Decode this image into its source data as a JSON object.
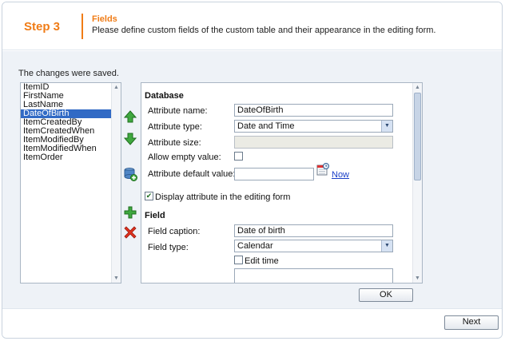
{
  "header": {
    "step": "Step 3",
    "title": "Fields",
    "description": "Please define custom fields of the custom table and their appearance in the editing form."
  },
  "status": {
    "message": "The changes were saved."
  },
  "attribute_list": {
    "items": [
      "ItemID",
      "FirstName",
      "LastName",
      "DateOfBirth",
      "ItemCreatedBy",
      "ItemCreatedWhen",
      "ItemModifiedBy",
      "ItemModifiedWhen",
      "ItemOrder"
    ],
    "selected": "DateOfBirth"
  },
  "toolbar_icons": [
    "move-up-icon",
    "move-down-icon",
    "new-field-from-db-icon",
    "add-field-icon",
    "delete-field-icon"
  ],
  "form": {
    "database_section": "Database",
    "attribute_name_label": "Attribute name:",
    "attribute_name_value": "DateOfBirth",
    "attribute_type_label": "Attribute type:",
    "attribute_type_value": "Date and Time",
    "attribute_size_label": "Attribute size:",
    "attribute_size_value": "",
    "allow_empty_label": "Allow empty value:",
    "allow_empty_checked": false,
    "default_value_label": "Attribute default value:",
    "default_value_value": "",
    "now_link": "Now",
    "display_in_form_label": "Display attribute in the editing form",
    "display_in_form_checked": true,
    "field_section": "Field",
    "field_caption_label": "Field caption:",
    "field_caption_value": "Date of birth",
    "field_type_label": "Field type:",
    "field_type_value": "Calendar",
    "edit_time_label": "Edit time",
    "edit_time_checked": false
  },
  "buttons": {
    "ok": "OK",
    "next": "Next"
  },
  "colors": {
    "accent": "#f07c16",
    "selection": "#316ac5",
    "content_bg": "#eef2f7",
    "link": "#1a3fc8"
  }
}
